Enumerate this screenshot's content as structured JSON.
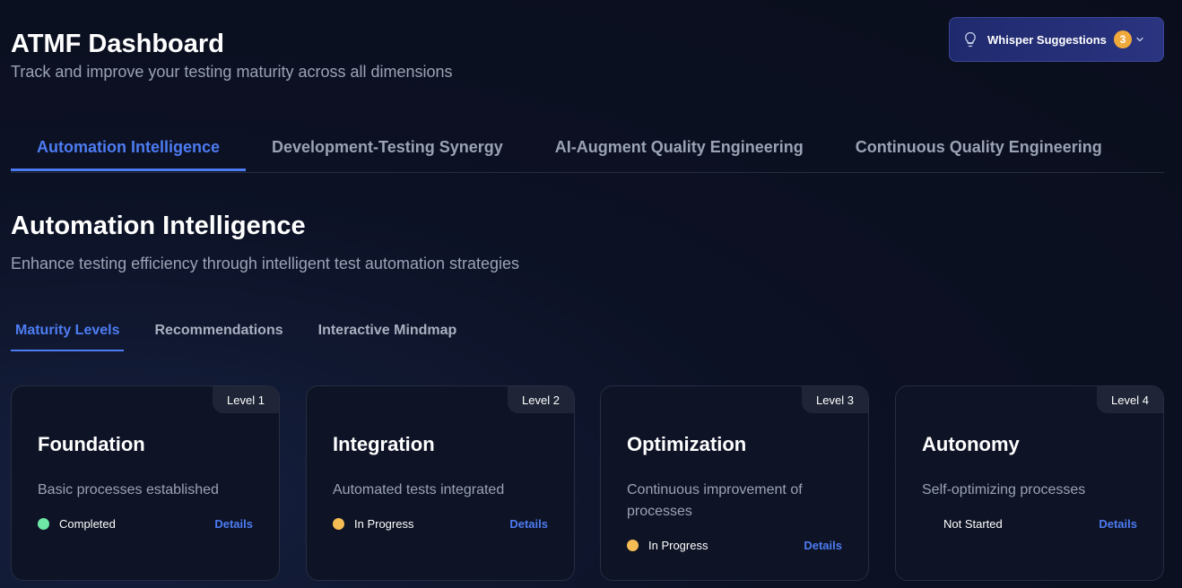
{
  "header": {
    "title": "ATMF Dashboard",
    "subtitle": "Track and improve your testing maturity across all dimensions"
  },
  "whisper": {
    "label": "Whisper Suggestions",
    "count": "3",
    "icon": "lightbulb-icon",
    "badge_color": "#f0a93b"
  },
  "main_tabs": [
    {
      "label": "Automation Intelligence",
      "active": true
    },
    {
      "label": "Development-Testing Synergy",
      "active": false
    },
    {
      "label": "AI-Augment Quality Engineering",
      "active": false
    },
    {
      "label": "Continuous Quality Engineering",
      "active": false
    }
  ],
  "section": {
    "title": "Automation Intelligence",
    "description": "Enhance testing efficiency through intelligent test automation strategies"
  },
  "sub_tabs": [
    {
      "label": "Maturity Levels",
      "active": true
    },
    {
      "label": "Recommendations",
      "active": false
    },
    {
      "label": "Interactive Mindmap",
      "active": false
    }
  ],
  "cards": [
    {
      "level": "Level 1",
      "title": "Foundation",
      "description": "Basic processes established",
      "status": "Completed",
      "status_color": "#6ee7a7",
      "details": "Details"
    },
    {
      "level": "Level 2",
      "title": "Integration",
      "description": "Automated tests integrated",
      "status": "In Progress",
      "status_color": "#f6bd55",
      "details": "Details"
    },
    {
      "level": "Level 3",
      "title": "Optimization",
      "description": "Continuous improvement of processes",
      "status": "In Progress",
      "status_color": "#f6bd55",
      "details": "Details"
    },
    {
      "level": "Level 4",
      "title": "Autonomy",
      "description": "Self-optimizing processes",
      "status": "Not Started",
      "status_color": "",
      "details": "Details"
    }
  ],
  "colors": {
    "accent": "#4d7cf2",
    "background": "#0a0e1c"
  }
}
